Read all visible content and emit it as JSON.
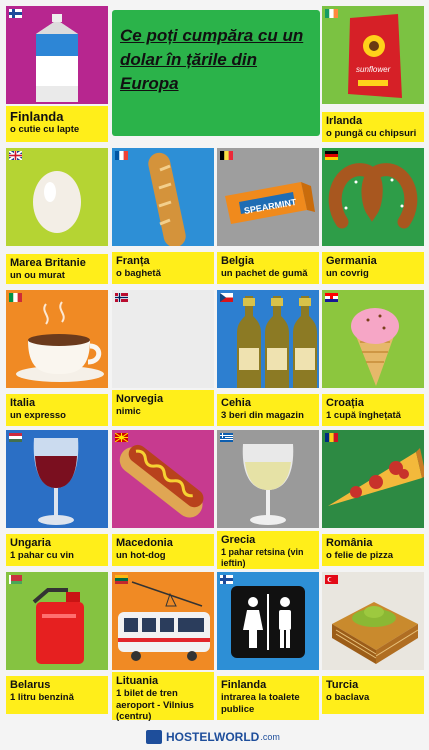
{
  "title": "Ce poți cumpăra cu un dolar în țările din Europa",
  "tiles": [
    {
      "country": "Finlanda",
      "item": "o cutie cu lapte",
      "icon": "milk-carton-icon",
      "flag": "finland-flag-icon"
    },
    {
      "country": "Irlanda",
      "item": "o pungă cu chipsuri",
      "icon": "chips-bag-icon",
      "flag": "ireland-flag-icon",
      "pic_text": "sunflower"
    },
    {
      "country": "Marea Britanie",
      "item": "un ou murat",
      "icon": "egg-icon",
      "flag": "uk-flag-icon"
    },
    {
      "country": "Franța",
      "item": "o baghetă",
      "icon": "baguette-icon",
      "flag": "france-flag-icon"
    },
    {
      "country": "Belgia",
      "item": "un pachet de gumă",
      "icon": "gum-pack-icon",
      "flag": "belgium-flag-icon",
      "pic_text": "SPEARMINT"
    },
    {
      "country": "Germania",
      "item": "un covrig",
      "icon": "pretzel-icon",
      "flag": "germany-flag-icon"
    },
    {
      "country": "Italia",
      "item": "un expresso",
      "icon": "espresso-cup-icon",
      "flag": "italy-flag-icon"
    },
    {
      "country": "Norvegia",
      "item": "nimic",
      "icon": "empty-icon",
      "flag": "norway-flag-icon"
    },
    {
      "country": "Cehia",
      "item": "3 beri din magazin",
      "icon": "beer-bottles-icon",
      "flag": "czech-flag-icon"
    },
    {
      "country": "Croația",
      "item": "1 cupă înghețată",
      "icon": "ice-cream-icon",
      "flag": "croatia-flag-icon"
    },
    {
      "country": "Ungaria",
      "item": "1 pahar cu vin",
      "icon": "red-wine-glass-icon",
      "flag": "hungary-flag-icon"
    },
    {
      "country": "Macedonia",
      "item": "un hot-dog",
      "icon": "hot-dog-icon",
      "flag": "macedonia-flag-icon"
    },
    {
      "country": "Grecia",
      "item": "1 pahar retsina (vin ieftin)",
      "icon": "white-wine-glass-icon",
      "flag": "greece-flag-icon"
    },
    {
      "country": "România",
      "item": "o felie de pizza",
      "icon": "pizza-slice-icon",
      "flag": "romania-flag-icon"
    },
    {
      "country": "Belarus",
      "item": "1 litru benzină",
      "icon": "fuel-can-icon",
      "flag": "belarus-flag-icon"
    },
    {
      "country": "Lituania",
      "item": "1 bilet de tren aeroport - Vilnius (centru)",
      "icon": "train-icon",
      "flag": "lithuania-flag-icon"
    },
    {
      "country": "Finlanda",
      "item": "intrarea la toalete publice",
      "icon": "restroom-sign-icon",
      "flag": "finland-flag-icon"
    },
    {
      "country": "Turcia",
      "item": "o baclava",
      "icon": "baklava-icon",
      "flag": "turkey-flag-icon"
    }
  ],
  "footer": {
    "brand": "HOSTELWORLD",
    "suffix": ".com"
  },
  "colors": {
    "caption": "#ffee1a",
    "title_bg": "#2bb34a",
    "brand": "#1e4e9b"
  }
}
